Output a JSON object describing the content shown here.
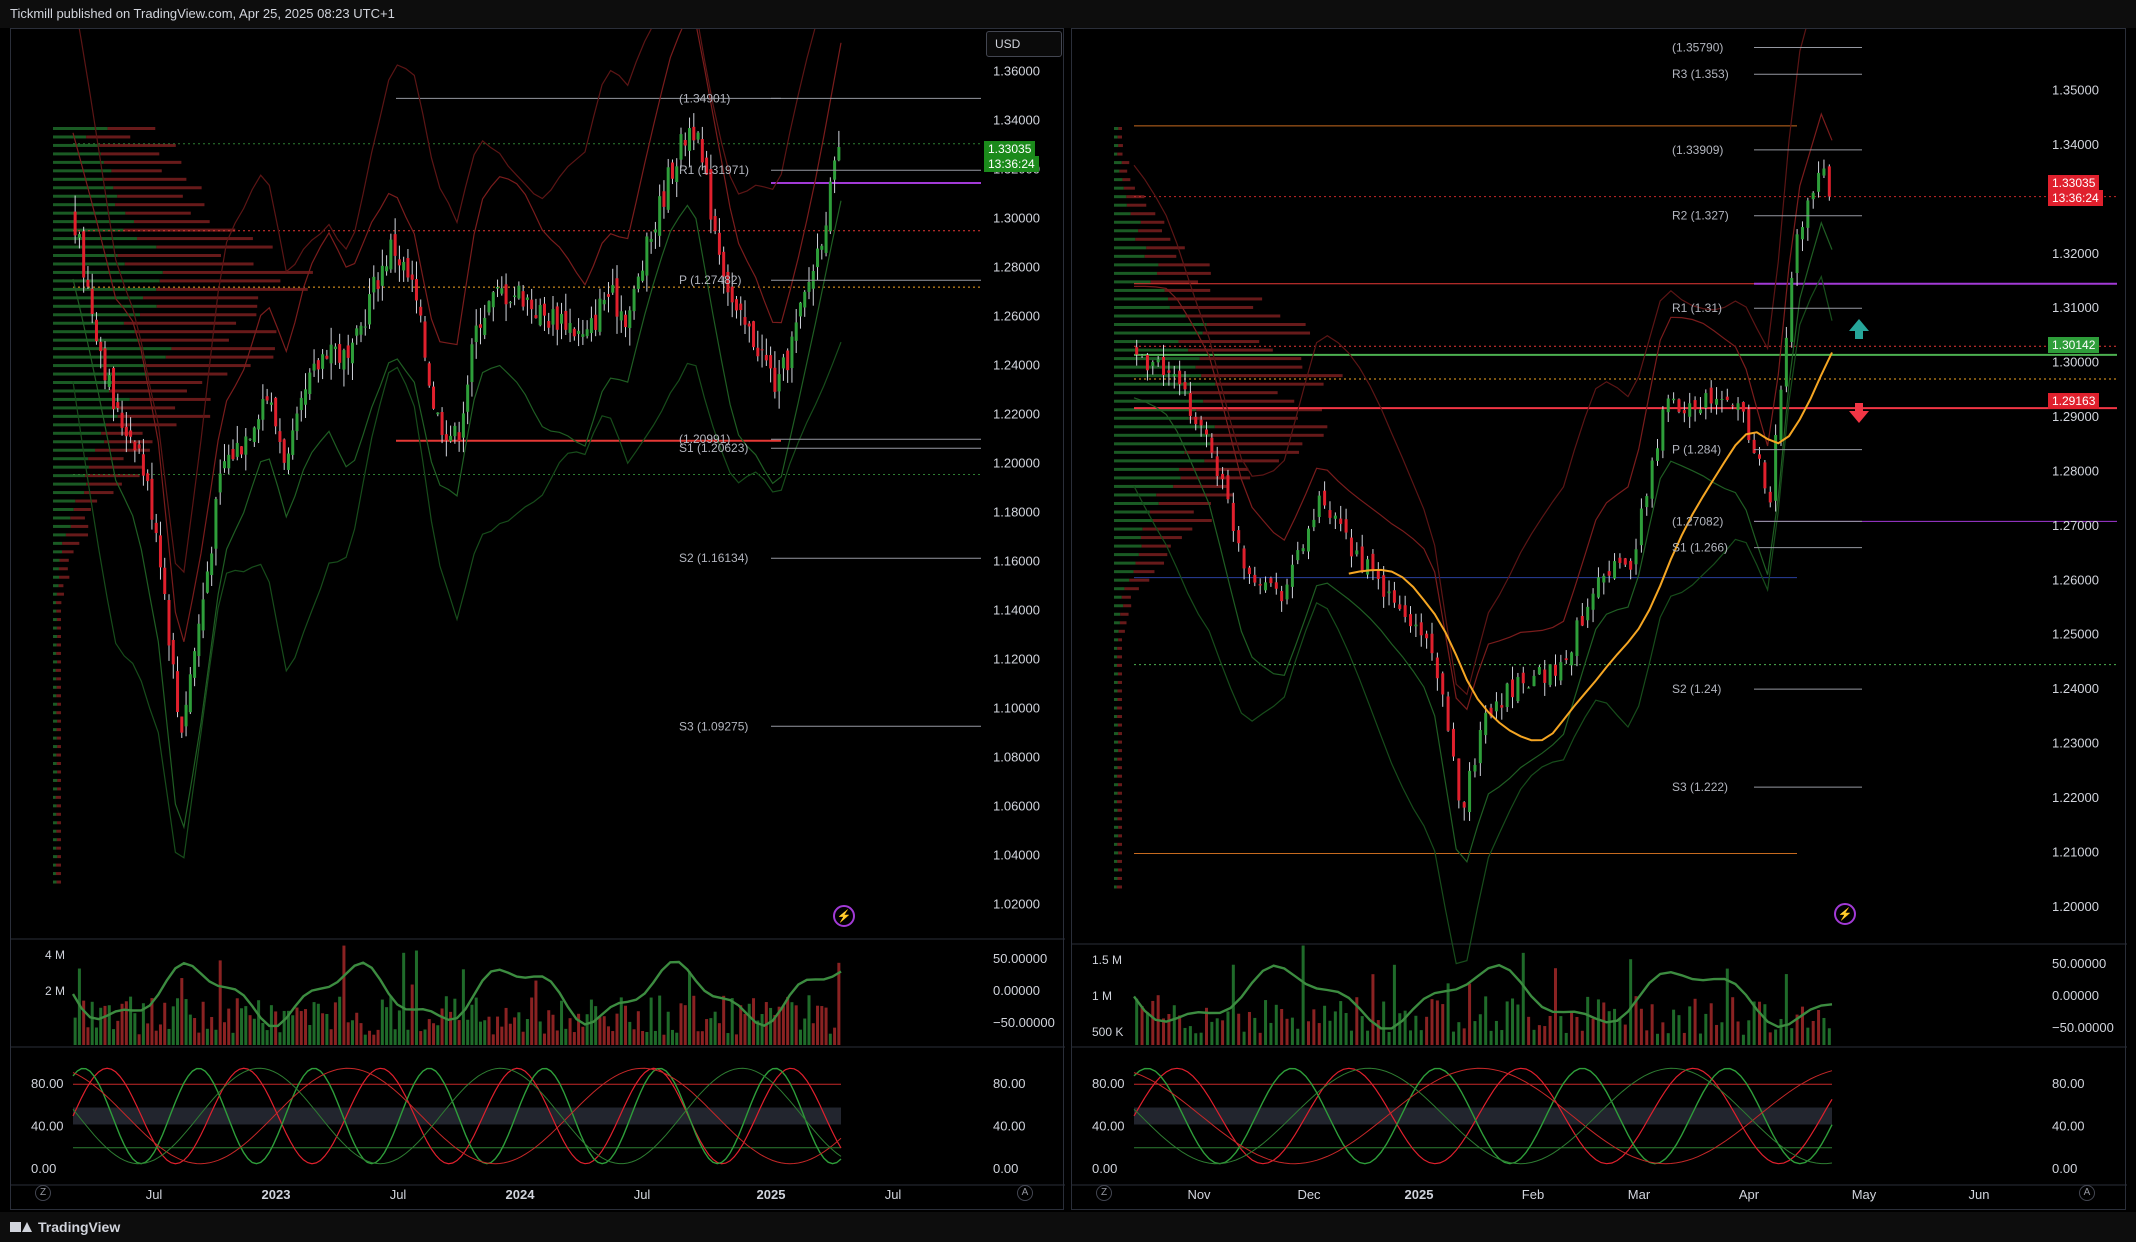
{
  "header": {
    "publisher": "Tickmill published on TradingView.com, Apr 25, 2025 08:23 UTC+1"
  },
  "footer": {
    "brand": "TradingView"
  },
  "colors": {
    "up": "#2e7d32",
    "down": "#d32f2f",
    "bg": "#000000",
    "grid_text": "#d1d4dc",
    "accent_orange": "#f5a623",
    "purple": "#a23ad6"
  },
  "chart_data": [
    {
      "type": "candlestick",
      "panel": "left",
      "currency": "USD",
      "ylim": [
        1.01,
        1.37
      ],
      "yticks": [
        "1.36000",
        "1.34000",
        "1.32000",
        "1.30000",
        "1.28000",
        "1.26000",
        "1.24000",
        "1.22000",
        "1.20000",
        "1.18000",
        "1.16000",
        "1.14000",
        "1.12000",
        "1.10000",
        "1.08000",
        "1.06000",
        "1.04000",
        "1.02000"
      ],
      "xticks": [
        "Jul",
        "2023",
        "Jul",
        "2024",
        "Jul",
        "2025",
        "Jul"
      ],
      "last_price": "1.33035",
      "countdown": "13:36:24",
      "pivot_labels": [
        {
          "label": "(1.34901)",
          "value": 1.34901
        },
        {
          "label": "R1 (1.31971)",
          "value": 1.31971
        },
        {
          "label": "P (1.27482)",
          "value": 1.27482
        },
        {
          "label": "S1 (1.20623)",
          "value": 1.20623
        },
        {
          "label": "(1.20991)",
          "value": 1.20991
        },
        {
          "label": "S2 (1.16134)",
          "value": 1.16134
        },
        {
          "label": "S3 (1.09275)",
          "value": 1.09275
        }
      ],
      "series": [
        {
          "name": "close",
          "x": [
            "2022-04",
            "2022-05",
            "2022-06",
            "2022-07",
            "2022-08",
            "2022-09",
            "2022-10",
            "2022-11",
            "2022-12",
            "2023-01",
            "2023-02",
            "2023-03",
            "2023-04",
            "2023-05",
            "2023-06",
            "2023-07",
            "2023-08",
            "2023-09",
            "2023-10",
            "2023-11",
            "2023-12",
            "2024-01",
            "2024-02",
            "2024-03",
            "2024-04",
            "2024-05",
            "2024-06",
            "2024-07",
            "2024-08",
            "2024-09",
            "2024-10",
            "2024-11",
            "2024-12",
            "2025-01",
            "2025-02",
            "2025-03",
            "2025-04"
          ],
          "values": [
            1.3,
            1.26,
            1.22,
            1.21,
            1.17,
            1.09,
            1.14,
            1.2,
            1.21,
            1.23,
            1.2,
            1.23,
            1.25,
            1.24,
            1.27,
            1.29,
            1.27,
            1.22,
            1.21,
            1.26,
            1.27,
            1.27,
            1.26,
            1.26,
            1.25,
            1.27,
            1.26,
            1.29,
            1.32,
            1.34,
            1.3,
            1.26,
            1.25,
            1.23,
            1.26,
            1.29,
            1.33
          ]
        }
      ],
      "indicators": [
        {
          "name": "volume",
          "yticks": [
            "4 M",
            "2 M"
          ]
        },
        {
          "name": "cci",
          "yticks": [
            "50.00000",
            "0.00000",
            "−50.00000"
          ]
        },
        {
          "name": "stochastic",
          "yticks": [
            "80.00",
            "40.00",
            "0.00"
          ],
          "right_ticks": [
            "80.00",
            "40.00",
            "0.00"
          ]
        }
      ]
    },
    {
      "type": "candlestick",
      "panel": "right",
      "ylim": [
        1.195,
        1.358
      ],
      "yticks": [
        "1.35000",
        "1.34000",
        "1.33000",
        "1.32000",
        "1.31000",
        "1.30000",
        "1.29000",
        "1.28000",
        "1.27000",
        "1.26000",
        "1.25000",
        "1.24000",
        "1.23000",
        "1.22000",
        "1.21000",
        "1.20000"
      ],
      "xticks": [
        "Nov",
        "Dec",
        "2025",
        "Feb",
        "Mar",
        "Apr",
        "May",
        "Jun"
      ],
      "last_price": "1.33035",
      "countdown": "13:36:24",
      "level_tags": [
        {
          "label": "1.30142",
          "value": 1.30142,
          "color": "#4caf50"
        },
        {
          "label": "1.29163",
          "value": 1.29163,
          "color": "#f23645"
        }
      ],
      "pivot_labels": [
        {
          "label": "(1.35790)",
          "value": 1.3579
        },
        {
          "label": "R3 (1.353)",
          "value": 1.353
        },
        {
          "label": "(1.33909)",
          "value": 1.33909
        },
        {
          "label": "R2 (1.327)",
          "value": 1.327
        },
        {
          "label": "R1 (1.31)",
          "value": 1.31
        },
        {
          "label": "P (1.284)",
          "value": 1.284
        },
        {
          "label": "(1.27082)",
          "value": 1.27082
        },
        {
          "label": "S1 (1.266)",
          "value": 1.266
        },
        {
          "label": "S2 (1.24)",
          "value": 1.24
        },
        {
          "label": "S3 (1.222)",
          "value": 1.222
        }
      ],
      "series": [
        {
          "name": "close",
          "x": [
            "2024-10-15",
            "2024-10-25",
            "2024-11-05",
            "2024-11-15",
            "2024-11-25",
            "2024-12-05",
            "2024-12-15",
            "2024-12-25",
            "2025-01-05",
            "2025-01-13",
            "2025-01-20",
            "2025-01-30",
            "2025-02-10",
            "2025-02-20",
            "2025-03-01",
            "2025-03-10",
            "2025-03-20",
            "2025-03-31",
            "2025-04-08",
            "2025-04-15",
            "2025-04-22",
            "2025-04-25"
          ],
          "values": [
            1.302,
            1.298,
            1.285,
            1.262,
            1.258,
            1.274,
            1.265,
            1.256,
            1.248,
            1.218,
            1.236,
            1.242,
            1.244,
            1.262,
            1.263,
            1.292,
            1.293,
            1.292,
            1.275,
            1.322,
            1.336,
            1.33
          ]
        }
      ],
      "indicators": [
        {
          "name": "volume",
          "yticks": [
            "1.5 M",
            "1 M",
            "500 K"
          ]
        },
        {
          "name": "cci",
          "yticks": [
            "50.00000",
            "0.00000",
            "−50.00000"
          ]
        },
        {
          "name": "stochastic",
          "yticks": [
            "80.00",
            "40.00",
            "0.00"
          ],
          "right_ticks": [
            "80.00",
            "40.00",
            "0.00"
          ]
        }
      ]
    }
  ]
}
